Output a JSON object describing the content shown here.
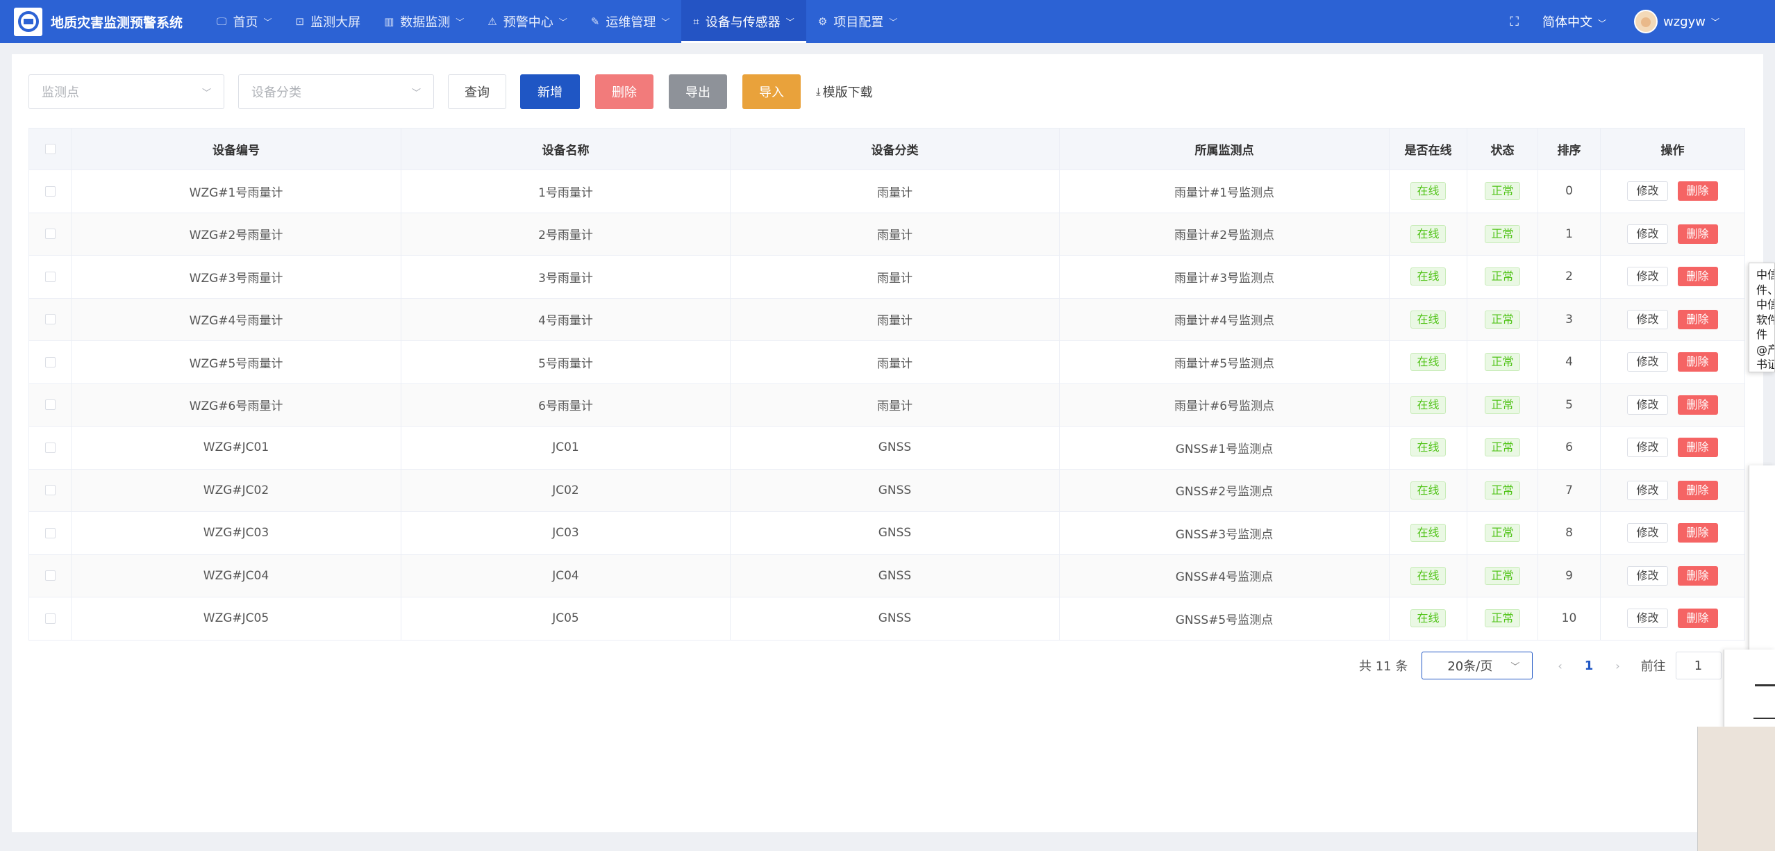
{
  "app": {
    "title": "地质灾害监测预警系统"
  },
  "nav": [
    {
      "label": "首页",
      "icon": "monitor-icon",
      "glyph": "🖵",
      "chev": true
    },
    {
      "label": "监测大屏",
      "icon": "screen-icon",
      "glyph": "⊡",
      "chev": false
    },
    {
      "label": "数据监测",
      "icon": "data-icon",
      "glyph": "▥",
      "chev": true
    },
    {
      "label": "预警中心",
      "icon": "alarm-icon",
      "glyph": "⚠",
      "chev": true
    },
    {
      "label": "运维管理",
      "icon": "wrench-icon",
      "glyph": "✎",
      "chev": true
    },
    {
      "label": "设备与传感器",
      "icon": "sensor-icon",
      "glyph": "⌗",
      "chev": true,
      "active": true
    },
    {
      "label": "项目配置",
      "icon": "config-icon",
      "glyph": "⚙",
      "chev": true
    }
  ],
  "header": {
    "lang": "简体中文",
    "user": "wzgyw"
  },
  "toolbar": {
    "monitor_point_placeholder": "监测点",
    "device_category_placeholder": "设备分类",
    "query": "查询",
    "add": "新增",
    "delete": "删除",
    "export": "导出",
    "import": "导入",
    "template": "模版下载"
  },
  "table": {
    "columns": [
      "设备编号",
      "设备名称",
      "设备分类",
      "所属监测点",
      "是否在线",
      "状态",
      "排序",
      "操作"
    ],
    "edit_label": "修改",
    "delete_label": "删除",
    "rows": [
      {
        "code": "WZG#1号雨量计",
        "name": "1号雨量计",
        "category": "雨量计",
        "point": "雨量计#1号监测点",
        "online": "在线",
        "status": "正常",
        "sort": "0"
      },
      {
        "code": "WZG#2号雨量计",
        "name": "2号雨量计",
        "category": "雨量计",
        "point": "雨量计#2号监测点",
        "online": "在线",
        "status": "正常",
        "sort": "1"
      },
      {
        "code": "WZG#3号雨量计",
        "name": "3号雨量计",
        "category": "雨量计",
        "point": "雨量计#3号监测点",
        "online": "在线",
        "status": "正常",
        "sort": "2"
      },
      {
        "code": "WZG#4号雨量计",
        "name": "4号雨量计",
        "category": "雨量计",
        "point": "雨量计#4号监测点",
        "online": "在线",
        "status": "正常",
        "sort": "3"
      },
      {
        "code": "WZG#5号雨量计",
        "name": "5号雨量计",
        "category": "雨量计",
        "point": "雨量计#5号监测点",
        "online": "在线",
        "status": "正常",
        "sort": "4"
      },
      {
        "code": "WZG#6号雨量计",
        "name": "6号雨量计",
        "category": "雨量计",
        "point": "雨量计#6号监测点",
        "online": "在线",
        "status": "正常",
        "sort": "5"
      },
      {
        "code": "WZG#JC01",
        "name": "JC01",
        "category": "GNSS",
        "point": "GNSS#1号监测点",
        "online": "在线",
        "status": "正常",
        "sort": "6"
      },
      {
        "code": "WZG#JC02",
        "name": "JC02",
        "category": "GNSS",
        "point": "GNSS#2号监测点",
        "online": "在线",
        "status": "正常",
        "sort": "7"
      },
      {
        "code": "WZG#JC03",
        "name": "JC03",
        "category": "GNSS",
        "point": "GNSS#3号监测点",
        "online": "在线",
        "status": "正常",
        "sort": "8"
      },
      {
        "code": "WZG#JC04",
        "name": "JC04",
        "category": "GNSS",
        "point": "GNSS#4号监测点",
        "online": "在线",
        "status": "正常",
        "sort": "9"
      },
      {
        "code": "WZG#JC05",
        "name": "JC05",
        "category": "GNSS",
        "point": "GNSS#5号监测点",
        "online": "在线",
        "status": "正常",
        "sort": "10"
      }
    ]
  },
  "pagination": {
    "total": "共 11 条",
    "page_size": "20条/页",
    "current_page": "1",
    "goto_label": "前往",
    "goto_value": "1"
  },
  "overlay_note": [
    "中信",
    "件、",
    "中信",
    "软件",
    "件",
    "@产",
    "书证"
  ],
  "colors": {
    "brand": "#2c62d4",
    "primary": "#1f56c4",
    "danger": "#f56464",
    "warning": "#e9a23b",
    "success": "#52c41a"
  }
}
